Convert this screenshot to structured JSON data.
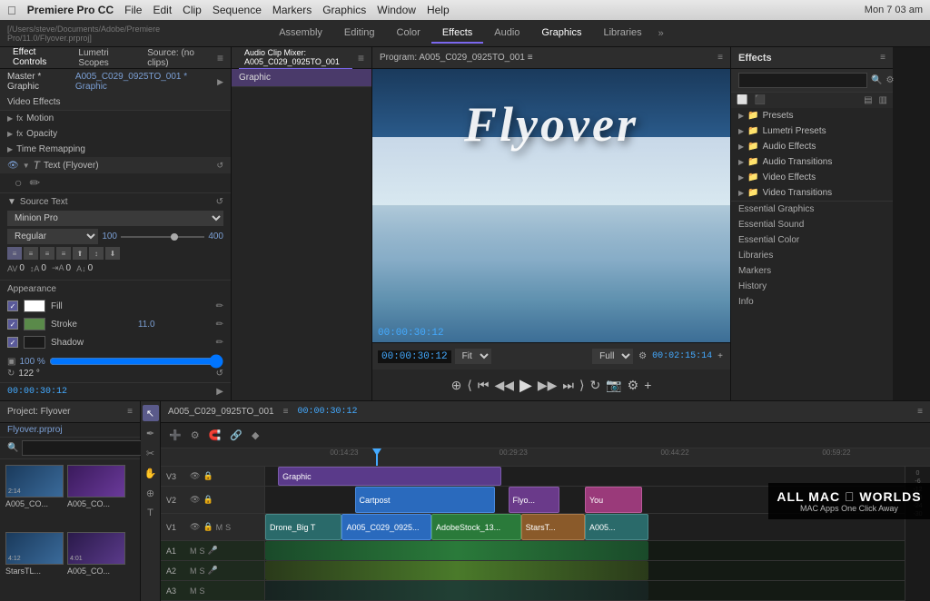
{
  "menubar": {
    "apple": "&#63743;",
    "items": [
      "Premiere Pro CC",
      "File",
      "Edit",
      "Clip",
      "Sequence",
      "Markers",
      "Graphics",
      "Window",
      "Help"
    ],
    "path": "[/Users/steve/Documents/Adobe/Premiere Pro/11.0/Flyover.prproj]",
    "right": "Mon 7 03 am"
  },
  "workspaceTabs": {
    "tabs": [
      "Assembly",
      "Editing",
      "Color",
      "Effects",
      "Audio",
      "Graphics",
      "Libraries"
    ],
    "active": "Effects",
    "more": "»"
  },
  "effectControls": {
    "title": "Effect Controls",
    "lumeritiTitle": "Lumetri Scopes",
    "sourceTitle": "Source: (no clips)",
    "masterLabel": "Master * Graphic",
    "clipLabel": "A005_C029_0925TO_001 * Graphic",
    "sections": {
      "videoEffects": "Video Effects",
      "motion": "Motion",
      "opacity": "Opacity",
      "timeRemapping": "Time Remapping",
      "textFlyover": "Text (Flyover)",
      "sourceText": "Source Text"
    },
    "font": "Minion Pro",
    "fontStyle": "Regular",
    "fontSize": "100",
    "fontSizeDisplay": "100",
    "tracking": "400",
    "appearance": {
      "title": "Appearance",
      "fill": "Fill",
      "stroke": "Stroke",
      "strokeVal": "11.0",
      "shadow": "Shadow"
    },
    "opacity": "100 %",
    "rotation": "122 °"
  },
  "programMonitor": {
    "title": "Program: A005_C029_0925TO_001 ≡",
    "flyoverText": "Flyover",
    "timecode": "00:00:30:12",
    "fit": "Fit",
    "full": "Full",
    "duration": "00:02:15:14"
  },
  "effectsPanel": {
    "title": "Effects",
    "searchPlaceholder": "",
    "categories": [
      "Presets",
      "Lumetri Presets",
      "Audio Effects",
      "Audio Transitions",
      "Video Effects",
      "Video Transitions"
    ],
    "essentialItems": [
      "Essential Graphics",
      "Essential Sound",
      "Essential Color",
      "Libraries",
      "Markers",
      "History",
      "Info"
    ]
  },
  "projectPanel": {
    "title": "Project: Flyover",
    "filename": "Flyover.prproj",
    "thumbnails": [
      {
        "label": "A005_CO...",
        "duration": "2:14"
      },
      {
        "label": "A005_CO...",
        "duration": ""
      },
      {
        "label": "StarsTL...",
        "duration": "4:12"
      },
      {
        "label": "A005_CO...",
        "duration": "4:01"
      }
    ]
  },
  "timeline": {
    "title": "A005_C029_0925TO_001",
    "timecode": "00:00:30:12",
    "timecodes": [
      "00:14:23",
      "00:29:23",
      "00:44:22",
      "00:59:22"
    ],
    "tracks": {
      "v3": "V3",
      "v2": "V2",
      "v1": "V1",
      "a1": "A1",
      "a2": "A2",
      "a3": "A3"
    },
    "clips": {
      "graphic": "Graphic",
      "cartpost": "Cartpost",
      "flyo": "Flyo...",
      "you": "You",
      "droneBig": "Drone_Big T",
      "a005": "A005_C029_0925...",
      "adobeStock": "AdobeStock_13...",
      "starsT": "StarsT...",
      "a005b": "A005..."
    }
  },
  "colors": {
    "accent": "#7b68ee",
    "timecode": "#44aaff",
    "clipBlue": "#2a6abd",
    "clipPurple": "#6a3a8a",
    "clipGreen": "#2a7a3a"
  },
  "watermark": {
    "title": "ALL MAC WORLDS",
    "subtitle": "MAC Apps One Click Away",
    "apple": "&#63743;"
  }
}
